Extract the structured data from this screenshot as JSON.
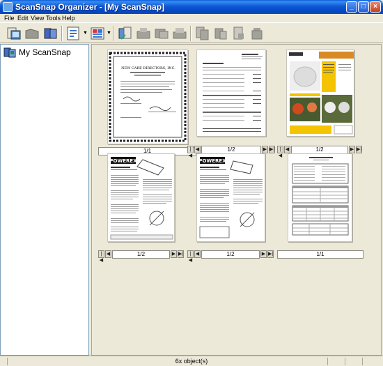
{
  "window": {
    "title": "ScanSnap Organizer - [My ScanSnap]",
    "controls": {
      "minimize": "_",
      "maximize": "□",
      "close": "×"
    }
  },
  "menu": {
    "items": [
      {
        "id": "file",
        "label": "File"
      },
      {
        "id": "edit",
        "label": "Edit"
      },
      {
        "id": "view",
        "label": "View"
      },
      {
        "id": "tools",
        "label": "Tools"
      },
      {
        "id": "help",
        "label": "Help"
      }
    ]
  },
  "toolbar": {
    "icons": [
      "scan-icon",
      "open-icon",
      "folder-icon",
      "view-mode-icon",
      "sort-icon",
      "export-icon",
      "print-icon",
      "mail-icon",
      "fax-icon",
      "copy-icon",
      "rotate-icon",
      "delete-icon"
    ]
  },
  "tree": {
    "root_label": "My ScanSnap"
  },
  "documents": [
    {
      "id": "doc1",
      "page": "1/1",
      "kind": "certificate"
    },
    {
      "id": "doc2",
      "page": "1/2",
      "kind": "invoice"
    },
    {
      "id": "doc3",
      "page": "1/2",
      "kind": "brochure"
    },
    {
      "id": "doc4",
      "page": "1/2",
      "kind": "manual"
    },
    {
      "id": "doc5",
      "page": "1/2",
      "kind": "manual"
    },
    {
      "id": "doc6",
      "page": "1/1",
      "kind": "form"
    }
  ],
  "thumbnail_text": {
    "doc1_heading": "NEW CARE DIRECTORS, INC.",
    "doc4_brand": "POWEREX",
    "doc5_brand": "POWEREX"
  },
  "status": {
    "count_text": "6x object(s)"
  }
}
